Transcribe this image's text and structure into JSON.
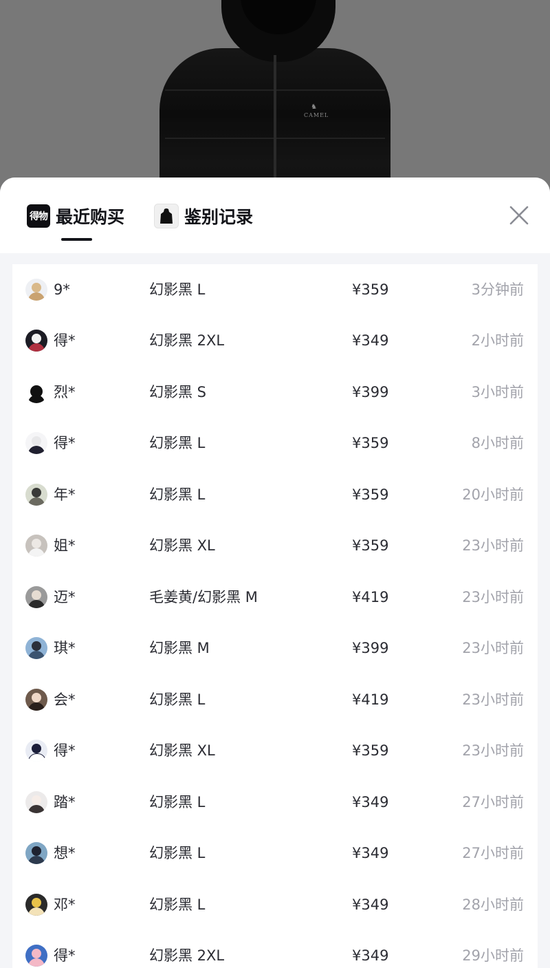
{
  "product_image": {
    "brand_text": "CAMEL"
  },
  "tabs": [
    {
      "label": "最近购买",
      "logo_text": "得物",
      "active": true
    },
    {
      "label": "鉴别记录",
      "active": false
    }
  ],
  "close_icon": "close-icon",
  "records": [
    {
      "name": "9*",
      "spec": "幻影黑 L",
      "price": "¥359",
      "time": "3分钟前"
    },
    {
      "name": "得*",
      "spec": "幻影黑 2XL",
      "price": "¥349",
      "time": "2小时前"
    },
    {
      "name": "烈*",
      "spec": "幻影黑 S",
      "price": "¥399",
      "time": "3小时前"
    },
    {
      "name": "得*",
      "spec": "幻影黑 L",
      "price": "¥359",
      "time": "8小时前"
    },
    {
      "name": "年*",
      "spec": "幻影黑 L",
      "price": "¥359",
      "time": "20小时前"
    },
    {
      "name": "姐*",
      "spec": "幻影黑 XL",
      "price": "¥359",
      "time": "23小时前"
    },
    {
      "name": "迈*",
      "spec": "毛姜黄/幻影黑 M",
      "price": "¥419",
      "time": "23小时前"
    },
    {
      "name": "琪*",
      "spec": "幻影黑 M",
      "price": "¥399",
      "time": "23小时前"
    },
    {
      "name": "会*",
      "spec": "幻影黑 L",
      "price": "¥419",
      "time": "23小时前"
    },
    {
      "name": "得*",
      "spec": "幻影黑 XL",
      "price": "¥359",
      "time": "23小时前"
    },
    {
      "name": "踏*",
      "spec": "幻影黑 L",
      "price": "¥349",
      "time": "27小时前"
    },
    {
      "name": "想*",
      "spec": "幻影黑 L",
      "price": "¥349",
      "time": "27小时前"
    },
    {
      "name": "邓*",
      "spec": "幻影黑 L",
      "price": "¥349",
      "time": "28小时前"
    },
    {
      "name": "得*",
      "spec": "幻影黑 2XL",
      "price": "¥349",
      "time": "29小时前"
    }
  ],
  "colors": {
    "text_primary": "#14151a",
    "text_time": "#a2a3ab",
    "sheet_bg": "#f4f5f8"
  }
}
